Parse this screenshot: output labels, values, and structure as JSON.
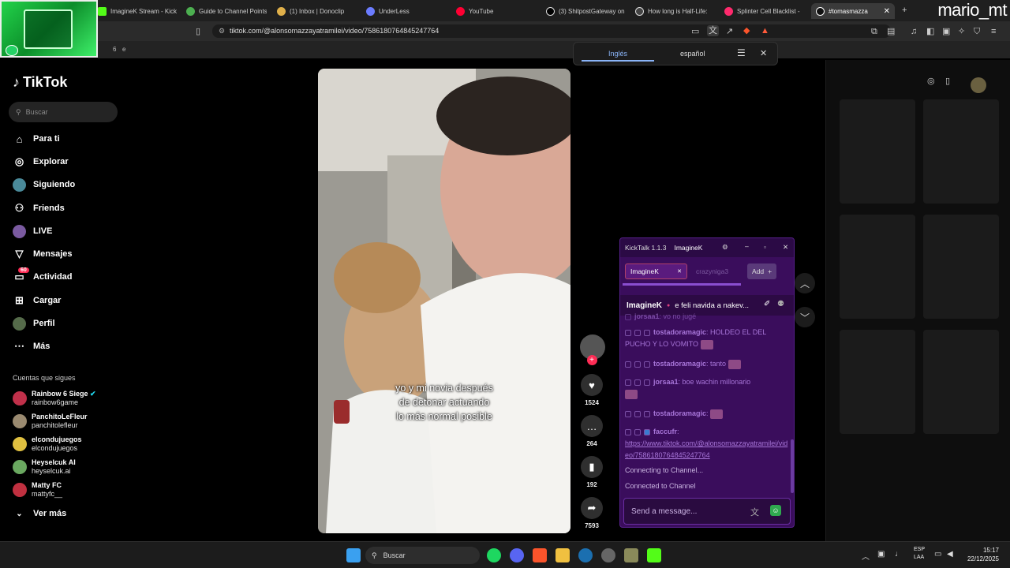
{
  "browser": {
    "tabs": [
      {
        "label": "ImagineK Stream - Kick",
        "color": "#53fc18"
      },
      {
        "label": "Guide to Channel Points",
        "color": "#4caf50"
      },
      {
        "label": "(1) Inbox | Donoclip",
        "color": "#e0b04a"
      },
      {
        "label": "UnderLess",
        "color": "#6b7cff"
      },
      {
        "label": "YouTube",
        "color": "#ff0033"
      },
      {
        "label": "(3) ShitpostGateway on",
        "color": "#dddddd"
      },
      {
        "label": "How long is Half-Life: ",
        "color": "#dddddd"
      },
      {
        "label": "Splinter Cell Blacklist -",
        "color": "#ff2a6d"
      },
      {
        "label": "#tomasmazza",
        "color": "#ffffff"
      }
    ],
    "url": "tiktok.com/@alonsomazzayatramilei/video/7586180764845247764",
    "bookmark_text": "e",
    "bookmark_count": "6",
    "streamer_name": "mario_mt"
  },
  "translate": {
    "lang_from": "Inglés",
    "lang_to": "español"
  },
  "sidebar": {
    "brand": "TikTok",
    "search_placeholder": "Buscar",
    "nav": [
      {
        "label": "Para ti",
        "icon": "home-icon"
      },
      {
        "label": "Explorar",
        "icon": "compass-icon"
      },
      {
        "label": "Siguiendo",
        "icon": "following-icon"
      },
      {
        "label": "Friends",
        "icon": "friends-icon"
      },
      {
        "label": "LIVE",
        "icon": "live-icon"
      },
      {
        "label": "Mensajes",
        "icon": "inbox-icon"
      },
      {
        "label": "Actividad",
        "icon": "activity-icon",
        "badge": "60"
      },
      {
        "label": "Cargar",
        "icon": "upload-icon"
      },
      {
        "label": "Perfil",
        "icon": "profile-icon"
      },
      {
        "label": "Más",
        "icon": "more-icon"
      }
    ],
    "following_heading": "Cuentas que sigues",
    "accounts": [
      {
        "name": "Rainbow 6 Siege",
        "handle": "rainbow6game",
        "verified": true,
        "color": "#c0304a"
      },
      {
        "name": "PanchitoLeFleur",
        "handle": "panchitolefleur",
        "color": "#9a8a70"
      },
      {
        "name": "elcondujuegos",
        "handle": "elcondujuegos",
        "color": "#e0c040"
      },
      {
        "name": "Heyselcuk AI",
        "handle": "heyselcuk.ai",
        "color": "#6aa860"
      },
      {
        "name": "Matty FC",
        "handle": "mattyfc__",
        "color": "#c03040"
      }
    ],
    "see_more": "Ver más"
  },
  "video": {
    "caption_lines": [
      "yo y mi novia después",
      "de detonar actuando",
      "lo más normal posible"
    ]
  },
  "actions": {
    "likes": "1524",
    "comments": "264",
    "saves": "192",
    "shares": "7593"
  },
  "kicktalk": {
    "title": "KickTalk 1.1.3",
    "current_user": "ImagineK",
    "tabs": [
      "ImagineK",
      "crazyniga3"
    ],
    "add_label": "Add",
    "pinned_user": "ImagineK",
    "pinned_text": "e feli navida a nakev...",
    "messages": [
      {
        "user": "jorsaa1",
        "text": "vo no jugé",
        "faded": true
      },
      {
        "user": "tostadoramagic",
        "text": "HOLDEO EL DEL PUCHO Y LO VOMITO"
      },
      {
        "user": "tostadoramagic",
        "text": "tanto"
      },
      {
        "user": "jorsaa1",
        "text": "boe wachin millonario"
      },
      {
        "user": "tostadoramagic",
        "text": ""
      },
      {
        "user": "faccufr",
        "text": "https://www.tiktok.com/@alonsomazzayatramilei/video/7586180764845247764"
      }
    ],
    "status_1": "Connecting to Channel...",
    "status_2": "Connected to Channel",
    "input_placeholder": "Send a message..."
  },
  "taskbar": {
    "search_label": "Buscar",
    "lang_line1": "ESP",
    "lang_line2": "LAA",
    "time": "15:17",
    "date": "22/12/2025"
  }
}
